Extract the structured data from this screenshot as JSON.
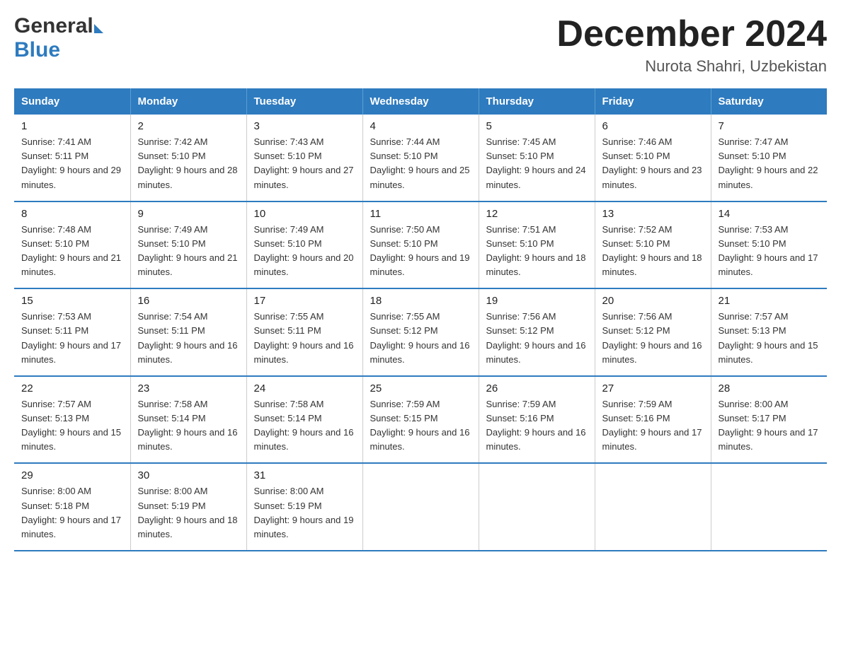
{
  "logo": {
    "line1": "General",
    "line2": "Blue"
  },
  "header": {
    "title": "December 2024",
    "subtitle": "Nurota Shahri, Uzbekistan"
  },
  "days_of_week": [
    "Sunday",
    "Monday",
    "Tuesday",
    "Wednesday",
    "Thursday",
    "Friday",
    "Saturday"
  ],
  "weeks": [
    [
      {
        "day": "1",
        "sunrise": "7:41 AM",
        "sunset": "5:11 PM",
        "daylight": "9 hours and 29 minutes."
      },
      {
        "day": "2",
        "sunrise": "7:42 AM",
        "sunset": "5:10 PM",
        "daylight": "9 hours and 28 minutes."
      },
      {
        "day": "3",
        "sunrise": "7:43 AM",
        "sunset": "5:10 PM",
        "daylight": "9 hours and 27 minutes."
      },
      {
        "day": "4",
        "sunrise": "7:44 AM",
        "sunset": "5:10 PM",
        "daylight": "9 hours and 25 minutes."
      },
      {
        "day": "5",
        "sunrise": "7:45 AM",
        "sunset": "5:10 PM",
        "daylight": "9 hours and 24 minutes."
      },
      {
        "day": "6",
        "sunrise": "7:46 AM",
        "sunset": "5:10 PM",
        "daylight": "9 hours and 23 minutes."
      },
      {
        "day": "7",
        "sunrise": "7:47 AM",
        "sunset": "5:10 PM",
        "daylight": "9 hours and 22 minutes."
      }
    ],
    [
      {
        "day": "8",
        "sunrise": "7:48 AM",
        "sunset": "5:10 PM",
        "daylight": "9 hours and 21 minutes."
      },
      {
        "day": "9",
        "sunrise": "7:49 AM",
        "sunset": "5:10 PM",
        "daylight": "9 hours and 21 minutes."
      },
      {
        "day": "10",
        "sunrise": "7:49 AM",
        "sunset": "5:10 PM",
        "daylight": "9 hours and 20 minutes."
      },
      {
        "day": "11",
        "sunrise": "7:50 AM",
        "sunset": "5:10 PM",
        "daylight": "9 hours and 19 minutes."
      },
      {
        "day": "12",
        "sunrise": "7:51 AM",
        "sunset": "5:10 PM",
        "daylight": "9 hours and 18 minutes."
      },
      {
        "day": "13",
        "sunrise": "7:52 AM",
        "sunset": "5:10 PM",
        "daylight": "9 hours and 18 minutes."
      },
      {
        "day": "14",
        "sunrise": "7:53 AM",
        "sunset": "5:10 PM",
        "daylight": "9 hours and 17 minutes."
      }
    ],
    [
      {
        "day": "15",
        "sunrise": "7:53 AM",
        "sunset": "5:11 PM",
        "daylight": "9 hours and 17 minutes."
      },
      {
        "day": "16",
        "sunrise": "7:54 AM",
        "sunset": "5:11 PM",
        "daylight": "9 hours and 16 minutes."
      },
      {
        "day": "17",
        "sunrise": "7:55 AM",
        "sunset": "5:11 PM",
        "daylight": "9 hours and 16 minutes."
      },
      {
        "day": "18",
        "sunrise": "7:55 AM",
        "sunset": "5:12 PM",
        "daylight": "9 hours and 16 minutes."
      },
      {
        "day": "19",
        "sunrise": "7:56 AM",
        "sunset": "5:12 PM",
        "daylight": "9 hours and 16 minutes."
      },
      {
        "day": "20",
        "sunrise": "7:56 AM",
        "sunset": "5:12 PM",
        "daylight": "9 hours and 16 minutes."
      },
      {
        "day": "21",
        "sunrise": "7:57 AM",
        "sunset": "5:13 PM",
        "daylight": "9 hours and 15 minutes."
      }
    ],
    [
      {
        "day": "22",
        "sunrise": "7:57 AM",
        "sunset": "5:13 PM",
        "daylight": "9 hours and 15 minutes."
      },
      {
        "day": "23",
        "sunrise": "7:58 AM",
        "sunset": "5:14 PM",
        "daylight": "9 hours and 16 minutes."
      },
      {
        "day": "24",
        "sunrise": "7:58 AM",
        "sunset": "5:14 PM",
        "daylight": "9 hours and 16 minutes."
      },
      {
        "day": "25",
        "sunrise": "7:59 AM",
        "sunset": "5:15 PM",
        "daylight": "9 hours and 16 minutes."
      },
      {
        "day": "26",
        "sunrise": "7:59 AM",
        "sunset": "5:16 PM",
        "daylight": "9 hours and 16 minutes."
      },
      {
        "day": "27",
        "sunrise": "7:59 AM",
        "sunset": "5:16 PM",
        "daylight": "9 hours and 17 minutes."
      },
      {
        "day": "28",
        "sunrise": "8:00 AM",
        "sunset": "5:17 PM",
        "daylight": "9 hours and 17 minutes."
      }
    ],
    [
      {
        "day": "29",
        "sunrise": "8:00 AM",
        "sunset": "5:18 PM",
        "daylight": "9 hours and 17 minutes."
      },
      {
        "day": "30",
        "sunrise": "8:00 AM",
        "sunset": "5:19 PM",
        "daylight": "9 hours and 18 minutes."
      },
      {
        "day": "31",
        "sunrise": "8:00 AM",
        "sunset": "5:19 PM",
        "daylight": "9 hours and 19 minutes."
      },
      {
        "day": "",
        "sunrise": "",
        "sunset": "",
        "daylight": ""
      },
      {
        "day": "",
        "sunrise": "",
        "sunset": "",
        "daylight": ""
      },
      {
        "day": "",
        "sunrise": "",
        "sunset": "",
        "daylight": ""
      },
      {
        "day": "",
        "sunrise": "",
        "sunset": "",
        "daylight": ""
      }
    ]
  ],
  "labels": {
    "sunrise": "Sunrise:",
    "sunset": "Sunset:",
    "daylight": "Daylight:"
  }
}
